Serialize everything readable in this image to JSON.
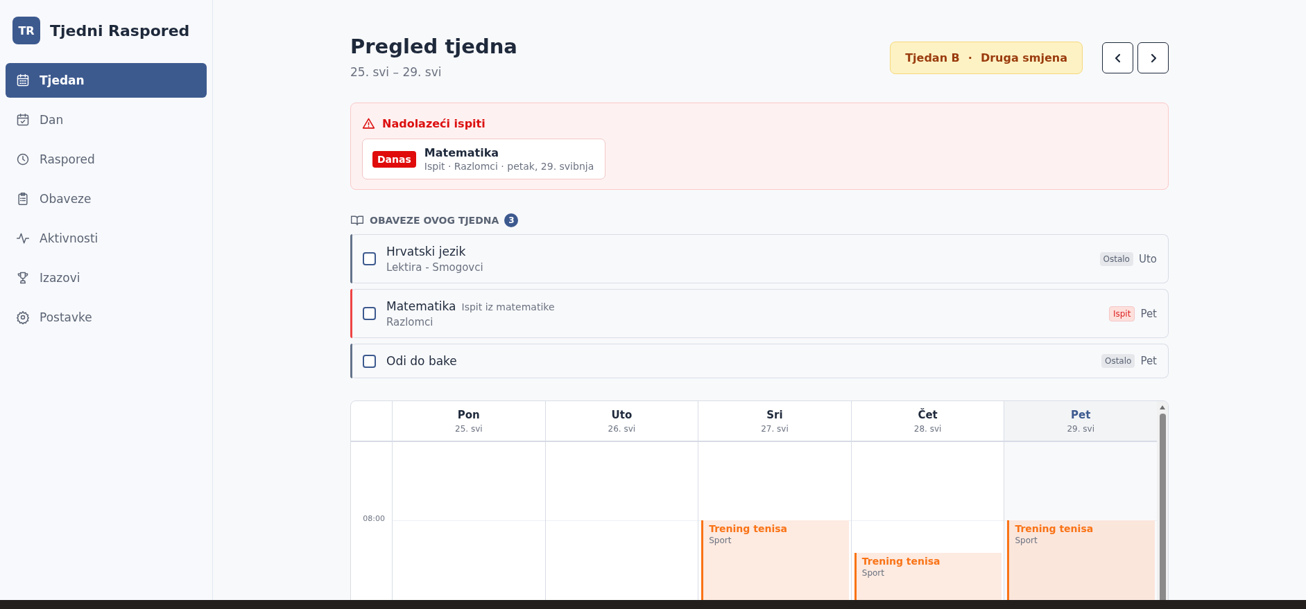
{
  "sidebar": {
    "logo": "TR",
    "title": "Tjedni Raspored",
    "items": [
      {
        "label": "Tjedan",
        "selected": true
      },
      {
        "label": "Dan",
        "selected": false
      },
      {
        "label": "Raspored",
        "selected": false
      },
      {
        "label": "Obaveze",
        "selected": false
      },
      {
        "label": "Aktivnosti",
        "selected": false
      },
      {
        "label": "Izazovi",
        "selected": false
      },
      {
        "label": "Postavke",
        "selected": false
      }
    ]
  },
  "header": {
    "title": "Pregled tjedna",
    "subtitle": "25. svi – 29. svi",
    "week_badge": {
      "week": "Tjedan B",
      "separator": "·",
      "shift": "Druga smjena"
    }
  },
  "alert": {
    "title": "Nadolazeći ispiti",
    "exams": [
      {
        "badge": "Danas",
        "subject": "Matematika",
        "details": "Ispit · Razlomci · petak, 29. svibnja"
      }
    ]
  },
  "tasks": {
    "heading": "OBAVEZE OVOG TJEDNA",
    "count": "3",
    "items": [
      {
        "title": "Hrvatski jezik",
        "subtitle": "Lektira - Smogovci",
        "tag": "Ostalo",
        "kind": "other",
        "day": "Uto",
        "checked": false,
        "color": "#64748b"
      },
      {
        "title": "Matematika",
        "note": "Ispit iz matematike",
        "subtitle": "Razlomci",
        "tag": "Ispit",
        "kind": "exam",
        "day": "Pet",
        "checked": false,
        "color": "#ef4444"
      },
      {
        "title": "Odi do bake",
        "tag": "Ostalo",
        "kind": "other",
        "day": "Pet",
        "checked": false,
        "color": "#64748b"
      }
    ]
  },
  "calendar": {
    "time_labels": [
      "08:00"
    ],
    "days": [
      {
        "name": "Pon",
        "date": "25. svi",
        "today": false
      },
      {
        "name": "Uto",
        "date": "26. svi",
        "today": false
      },
      {
        "name": "Sri",
        "date": "27. svi",
        "today": false,
        "events": [
          {
            "title": "Trening tenisa",
            "category": "Sport"
          }
        ]
      },
      {
        "name": "Čet",
        "date": "28. svi",
        "today": false,
        "events": [
          {
            "title": "Trening tenisa",
            "category": "Sport"
          }
        ]
      },
      {
        "name": "Pet",
        "date": "29. svi",
        "today": true,
        "events": [
          {
            "title": "Trening tenisa",
            "category": "Sport"
          }
        ]
      }
    ]
  }
}
